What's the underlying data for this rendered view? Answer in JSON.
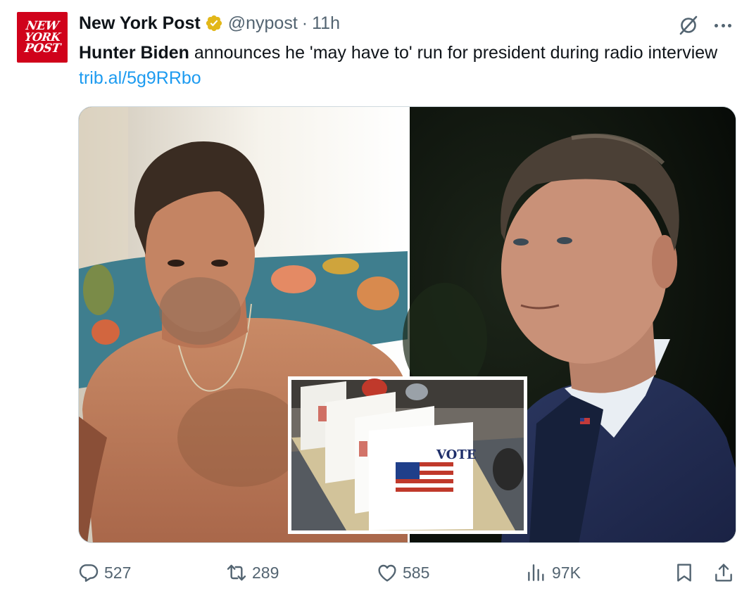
{
  "account": {
    "avatar_text": [
      "NEW",
      "YORK",
      "POST"
    ],
    "display_name": "New York Post",
    "handle": "@nypost",
    "separator": "·",
    "time": "11h"
  },
  "tweet": {
    "bold_text": "Hunter Biden",
    "text": " announces he 'may have to' run for president during radio interview ",
    "link": "trib.al/5g9RRbo"
  },
  "media": {
    "inset_sign_text": "VOTE"
  },
  "metrics": {
    "replies": "527",
    "retweets": "289",
    "likes": "585",
    "views": "97K"
  },
  "colors": {
    "brand_red": "#d0021b",
    "link_blue": "#1d9bf0",
    "muted": "#536471",
    "verified_gold": "#e2b719"
  },
  "icons": [
    "verified-badge-icon",
    "grok-icon",
    "more-icon",
    "reply-icon",
    "retweet-icon",
    "like-icon",
    "views-icon",
    "bookmark-icon",
    "share-icon"
  ]
}
